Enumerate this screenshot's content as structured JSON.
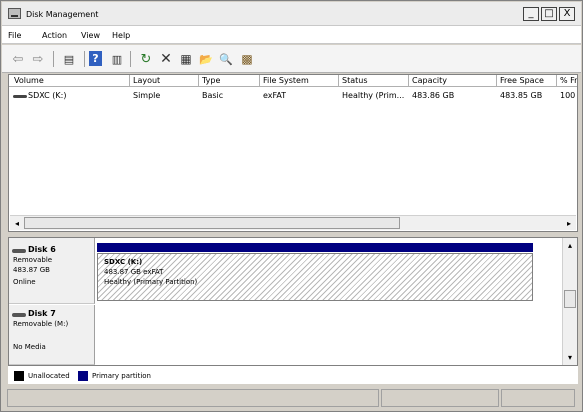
{
  "window": {
    "title": "Disk Management",
    "controls": {
      "minimize": "_",
      "maximize": "□",
      "close": "X"
    }
  },
  "menu": [
    "File",
    "Action",
    "View",
    "Help"
  ],
  "toolbar": {
    "icons": [
      "back-icon",
      "forward-icon",
      "console-tree-icon",
      "help-icon",
      "show-hide-action-pane-icon",
      "refresh-icon",
      "delete-icon",
      "properties-icon",
      "open-icon",
      "search-icon",
      "export-icon"
    ],
    "glyphs": {
      "back": "⇦",
      "forward": "⇨",
      "console": "▤",
      "help": "?",
      "pane": "▥",
      "refresh": "↻",
      "delete": "✕",
      "properties": "▦",
      "open": "📂",
      "search": "🔍",
      "export": "▩"
    }
  },
  "volumes": {
    "columns": [
      "Volume",
      "Layout",
      "Type",
      "File System",
      "Status",
      "Capacity",
      "Free Space",
      "% Fr"
    ],
    "rows": [
      {
        "volume": "SDXC (K:)",
        "layout": "Simple",
        "type": "Basic",
        "file_system": "exFAT",
        "status": "Healthy (Prim...",
        "capacity": "483.86 GB",
        "free_space": "483.85 GB",
        "percent_free": "100 %"
      }
    ]
  },
  "disks": [
    {
      "name": "Disk 6",
      "kind": "Removable",
      "size": "483.87 GB",
      "state": "Online",
      "partition": {
        "label": "SDXC  (K:)",
        "detail": "483.87 GB exFAT",
        "status": "Healthy (Primary Partition)"
      }
    },
    {
      "name": "Disk 7",
      "kind": "Removable (M:)",
      "state": "No Media"
    }
  ],
  "legend": [
    {
      "label": "Unallocated",
      "color": "#000000"
    },
    {
      "label": "Primary partition",
      "color": "#000080"
    }
  ],
  "scroll": {
    "arrow_left": "◂",
    "arrow_right": "▸",
    "arrow_up": "▴",
    "arrow_down": "▾"
  }
}
